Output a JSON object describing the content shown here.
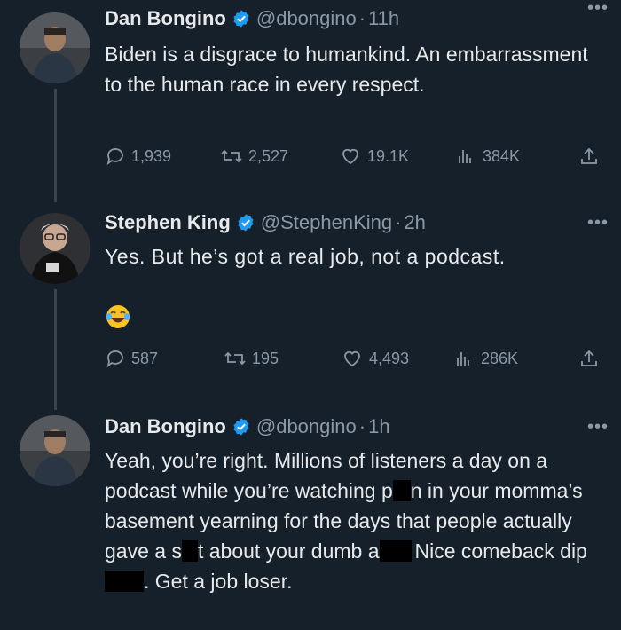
{
  "theme": {
    "background": "#15202b",
    "text": "#e7e9ea",
    "muted": "#8b98a5",
    "verified": "#1d9bf0"
  },
  "tweets": [
    {
      "name": "Dan Bongino",
      "handle": "@dbongino",
      "separator": "·",
      "time": "11h",
      "text": "Biden is a disgrace to humankind. An embarrassment to the human race in every respect.",
      "replies": "1,939",
      "retweets": "2,527",
      "likes": "19.1K",
      "views": "384K"
    },
    {
      "name": "Stephen King",
      "handle": "@StephenKing",
      "separator": "·",
      "time": "2h",
      "text": "Yes. But he’s got a real job, not a podcast.",
      "emoji": "laughing-with-tears-emoji",
      "replies": "587",
      "retweets": "195",
      "likes": "4,493",
      "views": "286K"
    },
    {
      "name": "Dan Bongino",
      "handle": "@dbongino",
      "separator": "·",
      "time": "1h",
      "text_parts": {
        "p1": "Yeah, you’re right. Millions of listeners a day on a podcast while you’re watching p",
        "p2": "n in your momma’s basement yearning for the days that people actually gave a s",
        "p3": "t about your dumb a",
        "p4": "Nice comeback dip",
        "p5": ". Get a job loser."
      }
    }
  ],
  "icons": [
    "reply-icon",
    "retweet-icon",
    "like-icon",
    "views-icon",
    "share-icon",
    "more-icon",
    "verified-badge-icon"
  ]
}
